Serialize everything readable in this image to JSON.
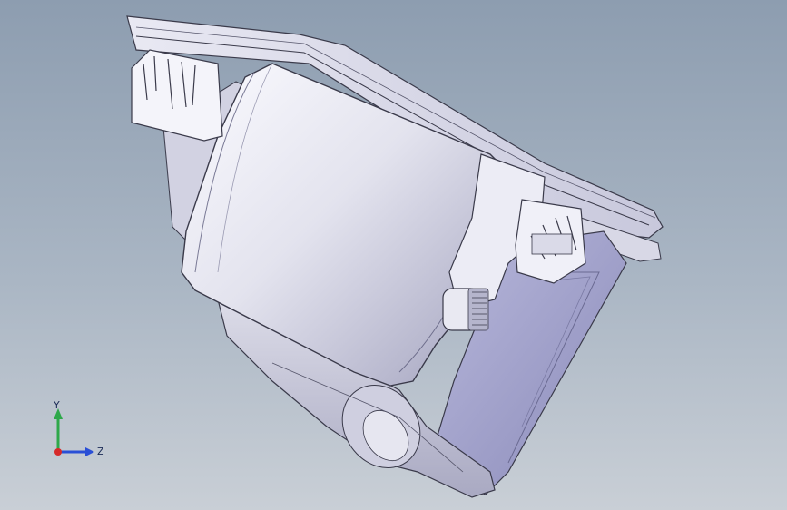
{
  "viewport": {
    "name": "3d-graphics-area"
  },
  "model": {
    "name": "camera-housing-assembly",
    "colors": {
      "body_light": "#f2f2f8",
      "body_mid": "#c9c9da",
      "body_dark": "#8f8fb0",
      "side_panel": "#9e9ec8",
      "edge": "#3a3a4a"
    }
  },
  "triad": {
    "x_label": "",
    "y_label": "Y",
    "z_label": "Z",
    "colors": {
      "y_axis": "#2ea84a",
      "z_axis": "#2a4fd6",
      "x_axis": "#d62a2a"
    }
  }
}
